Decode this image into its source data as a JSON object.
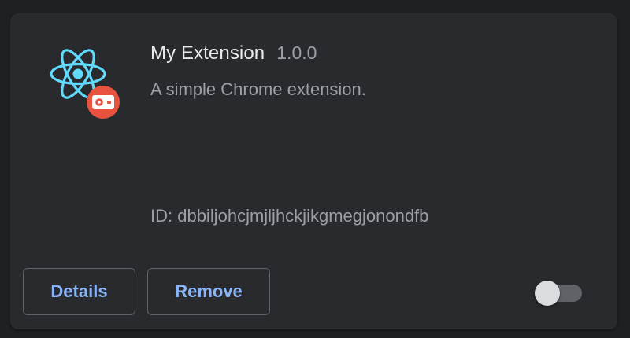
{
  "extension": {
    "name": "My Extension",
    "version": "1.0.0",
    "description": "A simple Chrome extension.",
    "id_text": "ID: dbbiljohcjmjljhckjikgmegjonondfb",
    "icon": "react-atom-icon",
    "badge_icon": "record-badge-icon",
    "enabled": false
  },
  "actions": {
    "details_label": "Details",
    "remove_label": "Remove"
  },
  "colors": {
    "background": "#1f2023",
    "card": "#292a2d",
    "title": "#e8eaed",
    "secondary_text": "#9aa0a6",
    "link": "#8ab4f8",
    "icon_accent": "#61dafb",
    "badge": "#e8533f",
    "toggle_track": "#5f6368",
    "toggle_knob": "#dadce0"
  }
}
